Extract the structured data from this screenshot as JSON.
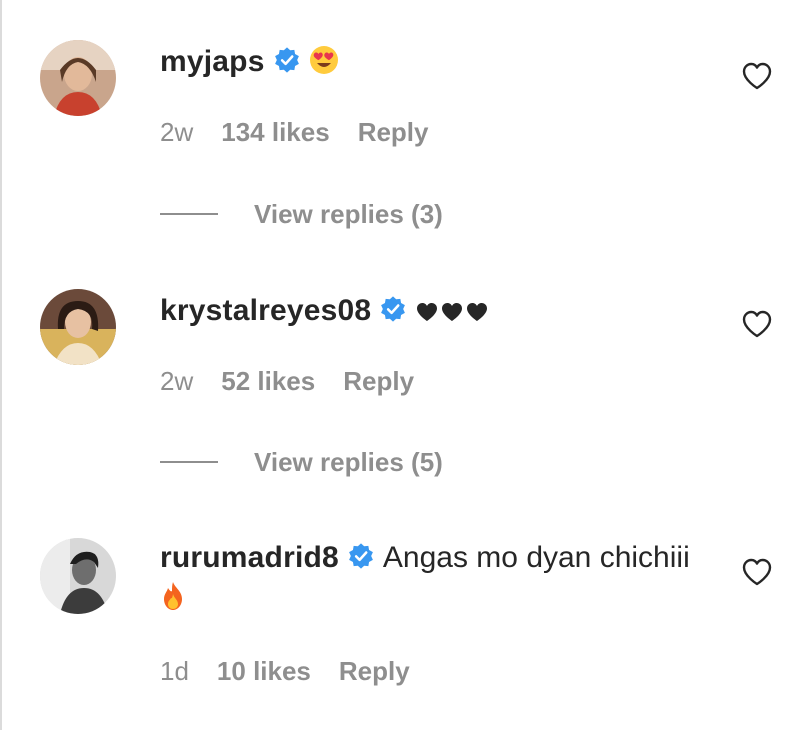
{
  "comments": [
    {
      "username": "myjaps",
      "verified": true,
      "text": "",
      "emoji": "heart-eyes",
      "age": "2w",
      "likes": "134 likes",
      "reply": "Reply",
      "view_replies": "View replies (3)"
    },
    {
      "username": "krystalreyes08",
      "verified": true,
      "text": "",
      "emoji": "black-hearts",
      "age": "2w",
      "likes": "52 likes",
      "reply": "Reply",
      "view_replies": "View replies (5)"
    },
    {
      "username": "rurumadrid8",
      "verified": true,
      "text": "Angas mo dyan chichiii",
      "emoji": "fire",
      "age": "1d",
      "likes": "10 likes",
      "reply": "Reply"
    }
  ],
  "colors": {
    "text": "#262626",
    "muted": "#8e8e8e",
    "verified": "#3897f0"
  },
  "icons": [
    "verified-badge-icon",
    "heart-outline-icon",
    "heart-eyes-emoji",
    "black-heart-emoji",
    "fire-emoji"
  ]
}
